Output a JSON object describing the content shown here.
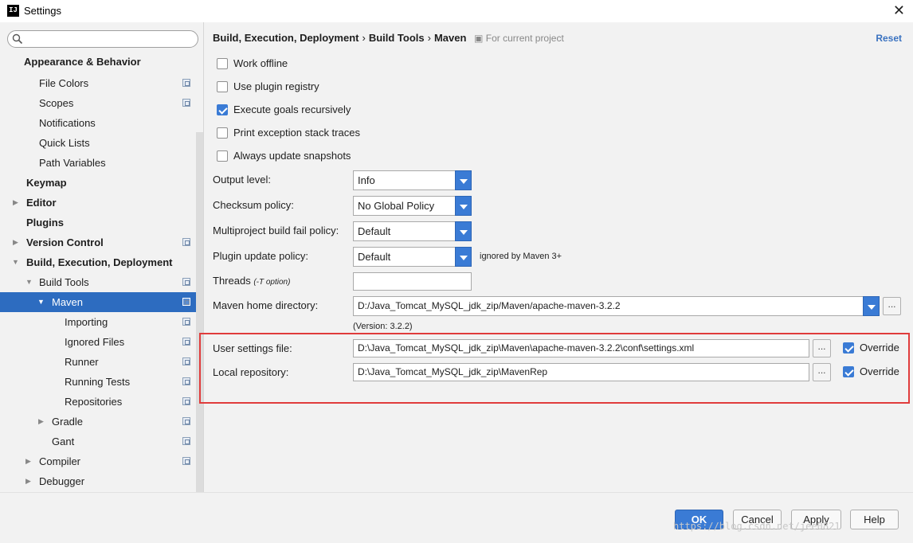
{
  "window": {
    "title": "Settings",
    "app_icon": "IJ"
  },
  "search": {
    "placeholder": ""
  },
  "sidebar": {
    "items": [
      {
        "label": "Appearance & Behavior"
      },
      {
        "label": "File Colors"
      },
      {
        "label": "Scopes"
      },
      {
        "label": "Notifications"
      },
      {
        "label": "Quick Lists"
      },
      {
        "label": "Path Variables"
      },
      {
        "label": "Keymap"
      },
      {
        "label": "Editor"
      },
      {
        "label": "Plugins"
      },
      {
        "label": "Version Control"
      },
      {
        "label": "Build, Execution, Deployment"
      },
      {
        "label": "Build Tools"
      },
      {
        "label": "Maven"
      },
      {
        "label": "Importing"
      },
      {
        "label": "Ignored Files"
      },
      {
        "label": "Runner"
      },
      {
        "label": "Running Tests"
      },
      {
        "label": "Repositories"
      },
      {
        "label": "Gradle"
      },
      {
        "label": "Gant"
      },
      {
        "label": "Compiler"
      },
      {
        "label": "Debugger"
      }
    ]
  },
  "header": {
    "crumb1": "Build, Execution, Deployment",
    "crumb2": "Build Tools",
    "crumb3": "Maven",
    "separator": "›",
    "scope": "For current project",
    "reset": "Reset"
  },
  "options": {
    "work_offline": {
      "label": "Work offline",
      "checked": false
    },
    "use_plugin_registry": {
      "label": "Use plugin registry",
      "checked": false
    },
    "execute_goals_recursively": {
      "label": "Execute goals recursively",
      "checked": true
    },
    "print_exception_stack_traces": {
      "label": "Print exception stack traces",
      "checked": false
    },
    "always_update_snapshots": {
      "label": "Always update snapshots",
      "checked": false
    }
  },
  "fields": {
    "output_level": {
      "label": "Output level:",
      "value": "Info"
    },
    "checksum_policy": {
      "label": "Checksum policy:",
      "value": "No Global Policy"
    },
    "multiproject_fail_policy": {
      "label": "Multiproject build fail policy:",
      "value": "Default"
    },
    "plugin_update_policy": {
      "label": "Plugin update policy:",
      "value": "Default",
      "note": "ignored by Maven 3+"
    },
    "threads": {
      "label": "Threads",
      "hint": "(-T option)",
      "value": ""
    },
    "maven_home": {
      "label": "Maven home directory:",
      "value": "D:/Java_Tomcat_MySQL_jdk_zip/Maven/apache-maven-3.2.2",
      "version": "(Version: 3.2.2)"
    },
    "user_settings_file": {
      "label": "User settings file:",
      "value": "D:\\Java_Tomcat_MySQL_jdk_zip\\Maven\\apache-maven-3.2.2\\conf\\settings.xml",
      "override_label": "Override",
      "override_checked": true
    },
    "local_repository": {
      "label": "Local repository:",
      "value": "D:\\Java_Tomcat_MySQL_jdk_zip\\MavenRep",
      "override_label": "Override",
      "override_checked": true
    },
    "browse_label": "..."
  },
  "buttons": {
    "ok": "OK",
    "cancel": "Cancel",
    "apply": "Apply",
    "help": "Help"
  },
  "watermark": "https://blog.csdn.net/jee0821",
  "colors": {
    "accent": "#3a7bd5",
    "selection": "#2d6cc0",
    "highlight_border": "#e03c3c"
  }
}
